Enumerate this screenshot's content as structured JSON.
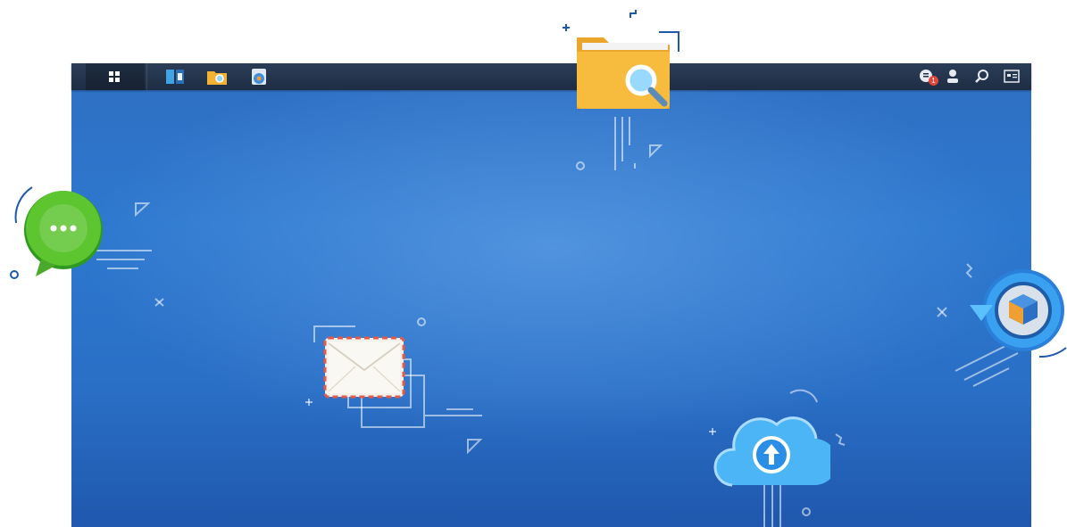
{
  "taskbar": {
    "main_menu": {
      "icon": "main-menu-icon"
    },
    "pinned_apps": [
      {
        "name": "package-center",
        "icon": "package-center-icon"
      },
      {
        "name": "file-station",
        "icon": "file-station-icon"
      },
      {
        "name": "control-panel",
        "icon": "control-panel-icon"
      }
    ],
    "notification_count": "1",
    "tray": [
      {
        "name": "notifications",
        "icon": "notification-icon"
      },
      {
        "name": "user",
        "icon": "user-icon"
      },
      {
        "name": "search",
        "icon": "search-icon"
      },
      {
        "name": "widgets",
        "icon": "widgets-icon"
      }
    ]
  },
  "desktop_illustration": {
    "featured_apps": [
      {
        "name": "file-station",
        "icon": "folder-search-icon",
        "color": "#f6b93b"
      },
      {
        "name": "chat",
        "icon": "chat-bubble-icon",
        "color": "#5cc52f"
      },
      {
        "name": "mail",
        "icon": "envelope-icon",
        "color": "#f4f1ea"
      },
      {
        "name": "cloud-sync",
        "icon": "cloud-upload-icon",
        "color": "#4bb5f5"
      },
      {
        "name": "hyper-backup",
        "icon": "backup-cube-icon",
        "color": "#2a8ee6"
      }
    ]
  },
  "colors": {
    "taskbar_bg": "#1e2d44",
    "desktop_bg": "#2d78cf",
    "badge": "#e0453a"
  }
}
